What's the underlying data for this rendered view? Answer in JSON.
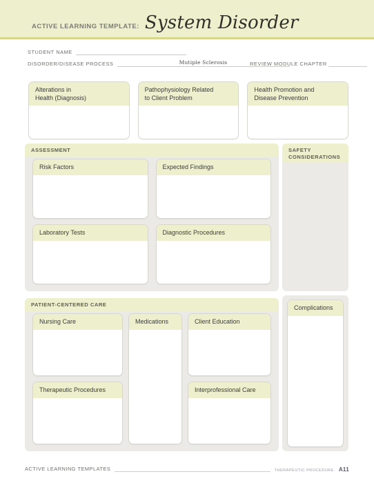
{
  "header": {
    "prefix_label": "ACTIVE LEARNING TEMPLATE:",
    "title": "System Disorder",
    "band_color": "#eef0cd",
    "rule_color": "#d8d68a"
  },
  "form": {
    "student_name_label": "STUDENT NAME",
    "student_name_value": "",
    "disorder_label": "DISORDER/DISEASE PROCESS",
    "disorder_value": "Mutiple Sclerosis",
    "review_label": "REVIEW MODULE CHAPTER",
    "review_value": ""
  },
  "top_boxes": [
    {
      "title": "Alterations in\nHealth (Diagnosis)",
      "line1": "Alterations in",
      "line2": "Health (Diagnosis)",
      "body": ""
    },
    {
      "title": "Pathophysiology Related\nto Client Problem",
      "line1": "Pathophysiology Related",
      "line2": "to Client Problem",
      "body": ""
    },
    {
      "title": "Health Promotion and\nDisease Prevention",
      "line1": "Health Promotion and",
      "line2": "Disease Prevention",
      "body": ""
    }
  ],
  "assessment": {
    "section_title": "ASSESSMENT",
    "boxes": [
      {
        "title": "Risk Factors",
        "body": ""
      },
      {
        "title": "Expected Findings",
        "body": ""
      },
      {
        "title": "Laboratory Tests",
        "body": ""
      },
      {
        "title": "Diagnostic Procedures",
        "body": ""
      }
    ]
  },
  "safety": {
    "title_line1": "SAFETY",
    "title_line2": "CONSIDERATIONS",
    "body": ""
  },
  "patient_centered_care": {
    "section_title": "PATIENT-CENTERED CARE",
    "left_column": [
      {
        "title": "Nursing Care",
        "body": ""
      },
      {
        "title": "Therapeutic Procedures",
        "body": ""
      }
    ],
    "middle_column": [
      {
        "title": "Medications",
        "body": ""
      }
    ],
    "right_column": [
      {
        "title": "Client Education",
        "body": ""
      },
      {
        "title": "Interprofessional Care",
        "body": ""
      }
    ]
  },
  "complications": {
    "title": "Complications",
    "body": ""
  },
  "footer": {
    "left_label": "ACTIVE LEARNING TEMPLATES",
    "right_label": "THERAPEUTIC PROCEDURE",
    "page": "A11"
  }
}
